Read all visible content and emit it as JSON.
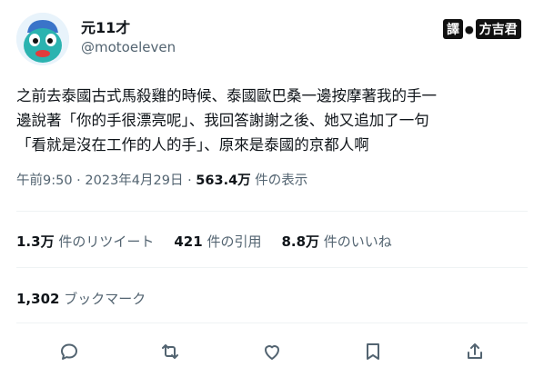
{
  "user": {
    "display_name": "元11才",
    "handle": "@motoeleven"
  },
  "translator_badge": {
    "prefix": "譯",
    "sep": "●",
    "name": "方吉君"
  },
  "tweet": {
    "text": "之前去泰國古式馬殺雞的時候、泰國歐巴桑一邊按摩著我的手一\n邊說著「你的手很漂亮呢」、我回答謝謝之後、她又追加了一句\n「看就是沒在工作的人的手」、原來是泰國的京都人啊"
  },
  "meta": {
    "time": "午前9:50",
    "dot": " · ",
    "date": "2023年4月29日",
    "dot2": " · ",
    "views_count": "563.4万",
    "views_label": " 件の表示"
  },
  "stats": {
    "retweets_count": "1.3万",
    "retweets_label": " 件のリツイート",
    "quotes_count": "421",
    "quotes_label": " 件の引用",
    "likes_count": "8.8万",
    "likes_label": " 件のいいね"
  },
  "bookmarks": {
    "count": "1,302",
    "label": " ブックマーク"
  },
  "icons": [
    "reply-icon",
    "retweet-icon",
    "like-icon",
    "bookmark-icon",
    "share-icon"
  ],
  "colors": {
    "text": "#0f1419",
    "secondary": "#536471",
    "divider": "#eff3f4",
    "avatar_face": "#2bb3b0"
  }
}
